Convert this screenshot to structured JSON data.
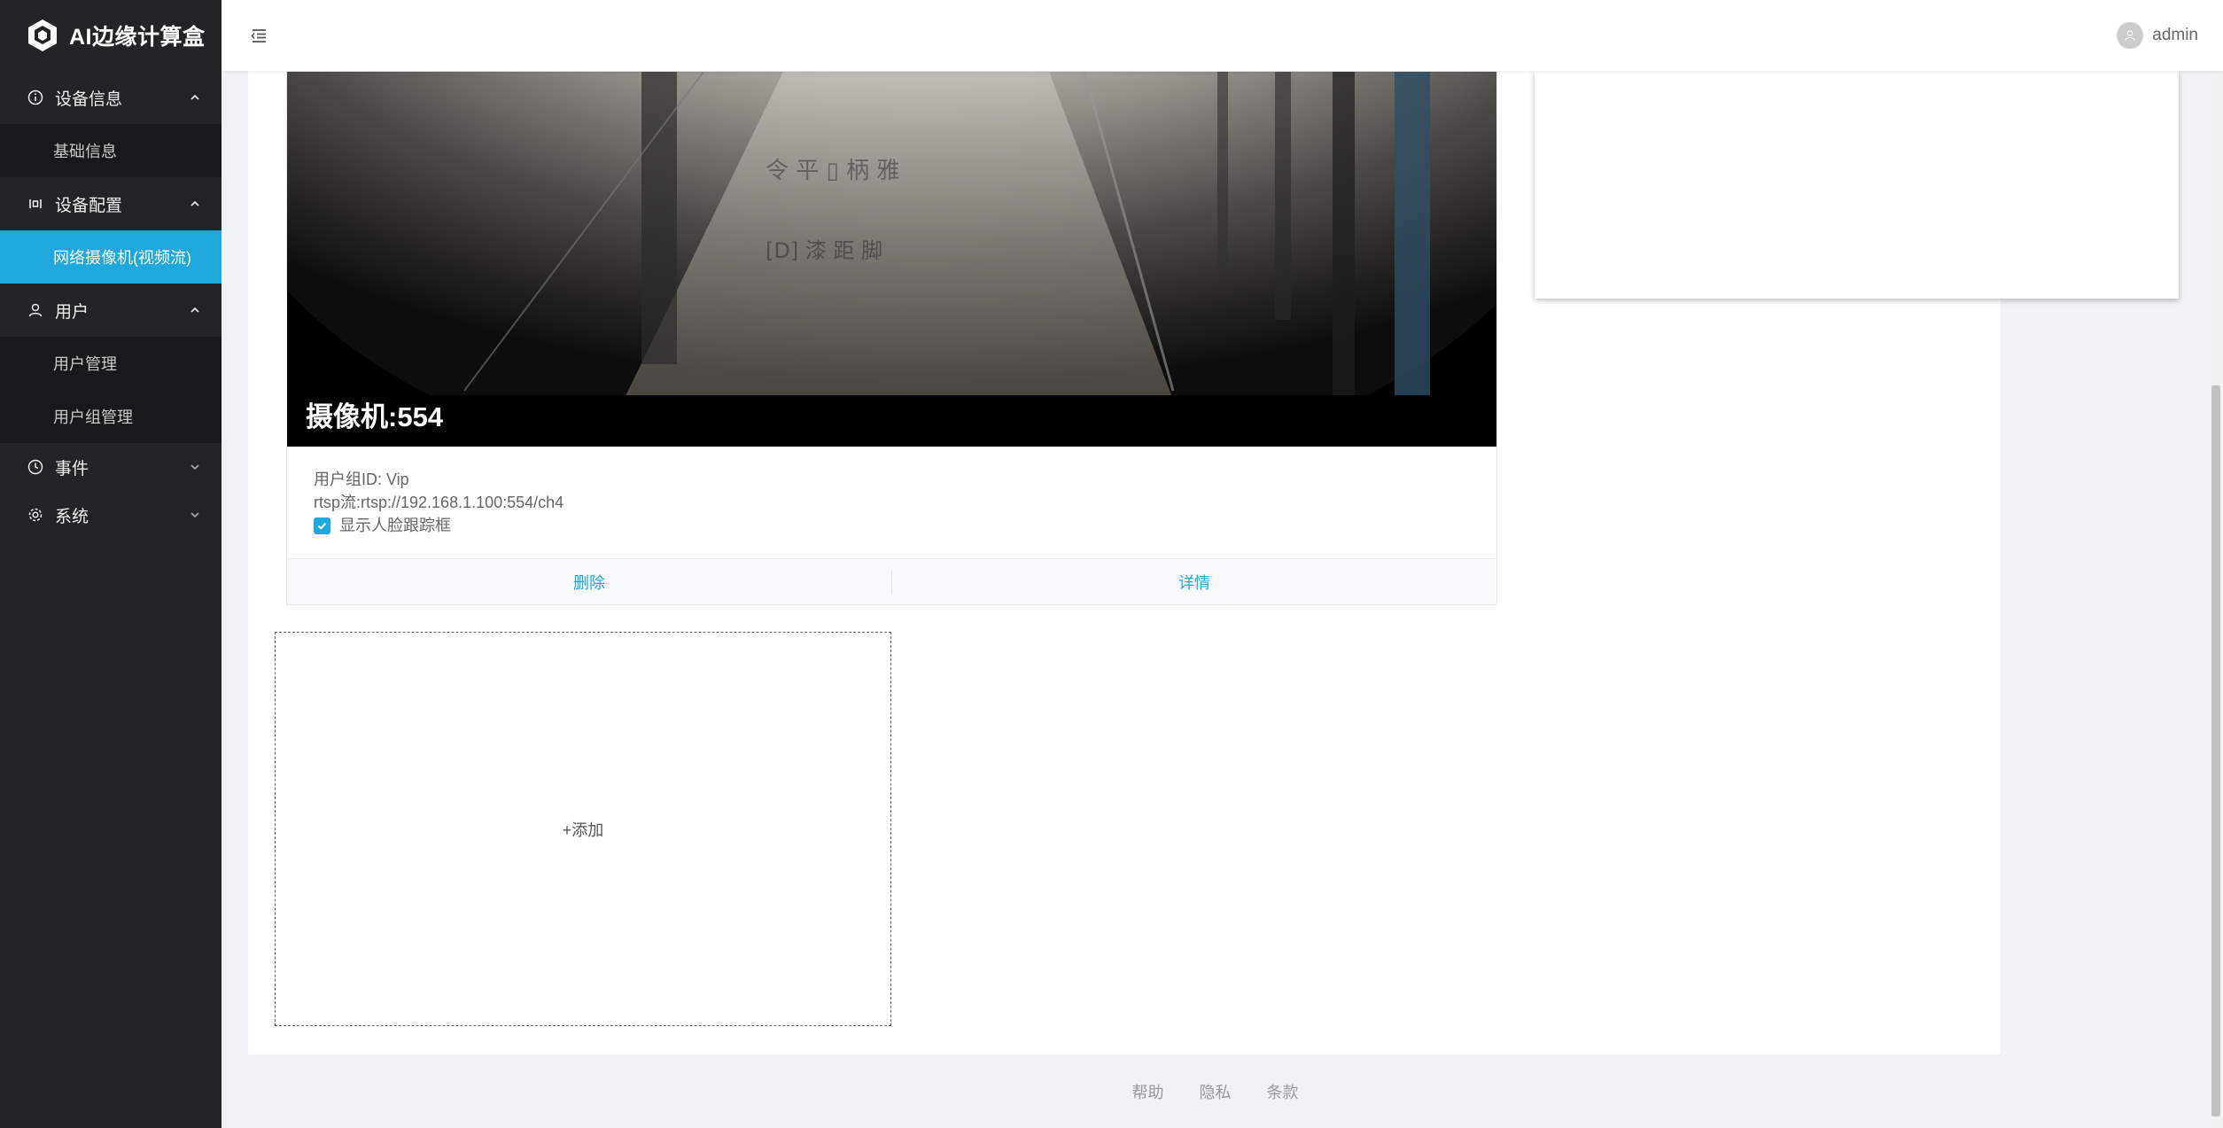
{
  "app": {
    "title": "AI边缘计算盒"
  },
  "sidebar": {
    "groups": [
      {
        "label": "设备信息",
        "icon": "info-icon",
        "expanded": true,
        "items": [
          {
            "label": "基础信息",
            "active": false
          }
        ]
      },
      {
        "label": "设备配置",
        "icon": "sliders-icon",
        "expanded": true,
        "items": [
          {
            "label": "网络摄像机(视频流)",
            "active": true
          }
        ]
      },
      {
        "label": "用户",
        "icon": "user-icon",
        "expanded": true,
        "items": [
          {
            "label": "用户管理",
            "active": false
          },
          {
            "label": "用户组管理",
            "active": false
          }
        ]
      },
      {
        "label": "事件",
        "icon": "clock-icon",
        "expanded": false,
        "items": []
      },
      {
        "label": "系统",
        "icon": "gear-icon",
        "expanded": false,
        "items": []
      }
    ]
  },
  "header": {
    "user": "admin"
  },
  "camera": {
    "caption": "摄像机:554",
    "group_line": "用户组ID: Vip",
    "rtsp_line": "rtsp流:rtsp://192.168.1.100:554/ch4",
    "face_tracking_label": "显示人脸跟踪框",
    "face_tracking_checked": true,
    "delete_label": "删除",
    "details_label": "详情"
  },
  "add": {
    "label": "+添加"
  },
  "footer": {
    "links": [
      "帮助",
      "隐私",
      "条款"
    ]
  },
  "colors": {
    "accent": "#1fa8dc",
    "sidebar_bg": "#222426"
  }
}
